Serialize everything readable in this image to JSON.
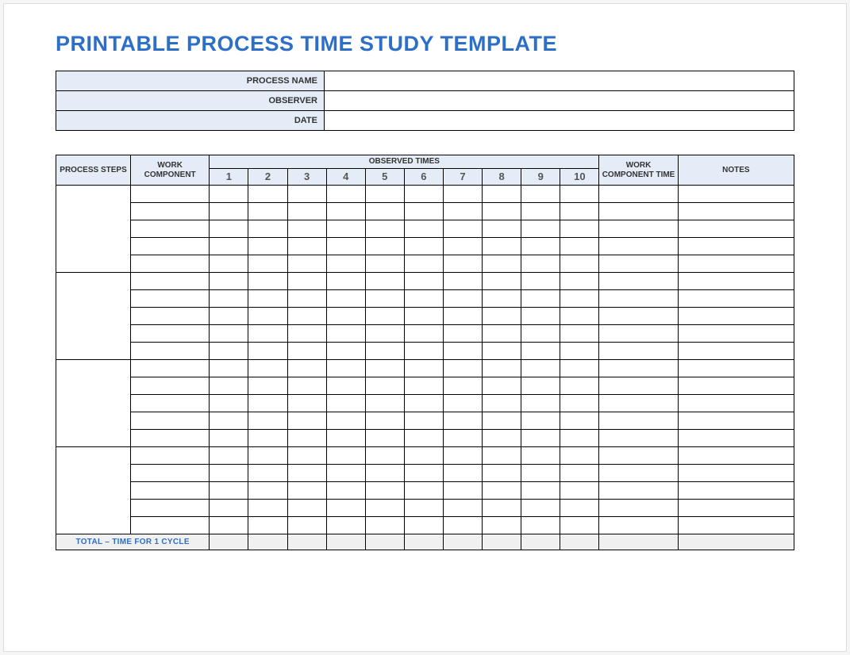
{
  "title": "PRINTABLE PROCESS TIME STUDY TEMPLATE",
  "info": {
    "processName": {
      "label": "PROCESS NAME",
      "value": ""
    },
    "observer": {
      "label": "OBSERVER",
      "value": ""
    },
    "date": {
      "label": "DATE",
      "value": ""
    }
  },
  "headers": {
    "processSteps": "PROCESS STEPS",
    "workComponent": "WORK COMPONENT",
    "observedTimes": "OBSERVED TIMES",
    "workComponentTime": "WORK COMPONENT TIME",
    "notes": "NOTES",
    "nums": [
      "1",
      "2",
      "3",
      "4",
      "5",
      "6",
      "7",
      "8",
      "9",
      "10"
    ]
  },
  "groups": [
    {
      "step": "",
      "rows": [
        {
          "component": "",
          "times": [
            "",
            "",
            "",
            "",
            "",
            "",
            "",
            "",
            "",
            ""
          ],
          "workTime": "",
          "notes": ""
        },
        {
          "component": "",
          "times": [
            "",
            "",
            "",
            "",
            "",
            "",
            "",
            "",
            "",
            ""
          ],
          "workTime": "",
          "notes": ""
        },
        {
          "component": "",
          "times": [
            "",
            "",
            "",
            "",
            "",
            "",
            "",
            "",
            "",
            ""
          ],
          "workTime": "",
          "notes": ""
        },
        {
          "component": "",
          "times": [
            "",
            "",
            "",
            "",
            "",
            "",
            "",
            "",
            "",
            ""
          ],
          "workTime": "",
          "notes": ""
        },
        {
          "component": "",
          "times": [
            "",
            "",
            "",
            "",
            "",
            "",
            "",
            "",
            "",
            ""
          ],
          "workTime": "",
          "notes": ""
        }
      ]
    },
    {
      "step": "",
      "rows": [
        {
          "component": "",
          "times": [
            "",
            "",
            "",
            "",
            "",
            "",
            "",
            "",
            "",
            ""
          ],
          "workTime": "",
          "notes": ""
        },
        {
          "component": "",
          "times": [
            "",
            "",
            "",
            "",
            "",
            "",
            "",
            "",
            "",
            ""
          ],
          "workTime": "",
          "notes": ""
        },
        {
          "component": "",
          "times": [
            "",
            "",
            "",
            "",
            "",
            "",
            "",
            "",
            "",
            ""
          ],
          "workTime": "",
          "notes": ""
        },
        {
          "component": "",
          "times": [
            "",
            "",
            "",
            "",
            "",
            "",
            "",
            "",
            "",
            ""
          ],
          "workTime": "",
          "notes": ""
        },
        {
          "component": "",
          "times": [
            "",
            "",
            "",
            "",
            "",
            "",
            "",
            "",
            "",
            ""
          ],
          "workTime": "",
          "notes": ""
        }
      ]
    },
    {
      "step": "",
      "rows": [
        {
          "component": "",
          "times": [
            "",
            "",
            "",
            "",
            "",
            "",
            "",
            "",
            "",
            ""
          ],
          "workTime": "",
          "notes": ""
        },
        {
          "component": "",
          "times": [
            "",
            "",
            "",
            "",
            "",
            "",
            "",
            "",
            "",
            ""
          ],
          "workTime": "",
          "notes": ""
        },
        {
          "component": "",
          "times": [
            "",
            "",
            "",
            "",
            "",
            "",
            "",
            "",
            "",
            ""
          ],
          "workTime": "",
          "notes": ""
        },
        {
          "component": "",
          "times": [
            "",
            "",
            "",
            "",
            "",
            "",
            "",
            "",
            "",
            ""
          ],
          "workTime": "",
          "notes": ""
        },
        {
          "component": "",
          "times": [
            "",
            "",
            "",
            "",
            "",
            "",
            "",
            "",
            "",
            ""
          ],
          "workTime": "",
          "notes": ""
        }
      ]
    },
    {
      "step": "",
      "rows": [
        {
          "component": "",
          "times": [
            "",
            "",
            "",
            "",
            "",
            "",
            "",
            "",
            "",
            ""
          ],
          "workTime": "",
          "notes": ""
        },
        {
          "component": "",
          "times": [
            "",
            "",
            "",
            "",
            "",
            "",
            "",
            "",
            "",
            ""
          ],
          "workTime": "",
          "notes": ""
        },
        {
          "component": "",
          "times": [
            "",
            "",
            "",
            "",
            "",
            "",
            "",
            "",
            "",
            ""
          ],
          "workTime": "",
          "notes": ""
        },
        {
          "component": "",
          "times": [
            "",
            "",
            "",
            "",
            "",
            "",
            "",
            "",
            "",
            ""
          ],
          "workTime": "",
          "notes": ""
        },
        {
          "component": "",
          "times": [
            "",
            "",
            "",
            "",
            "",
            "",
            "",
            "",
            "",
            ""
          ],
          "workTime": "",
          "notes": ""
        }
      ]
    }
  ],
  "totalRow": {
    "label": "TOTAL – TIME FOR 1 CYCLE",
    "times": [
      "",
      "",
      "",
      "",
      "",
      "",
      "",
      "",
      "",
      ""
    ],
    "workTime": "",
    "notes": ""
  }
}
